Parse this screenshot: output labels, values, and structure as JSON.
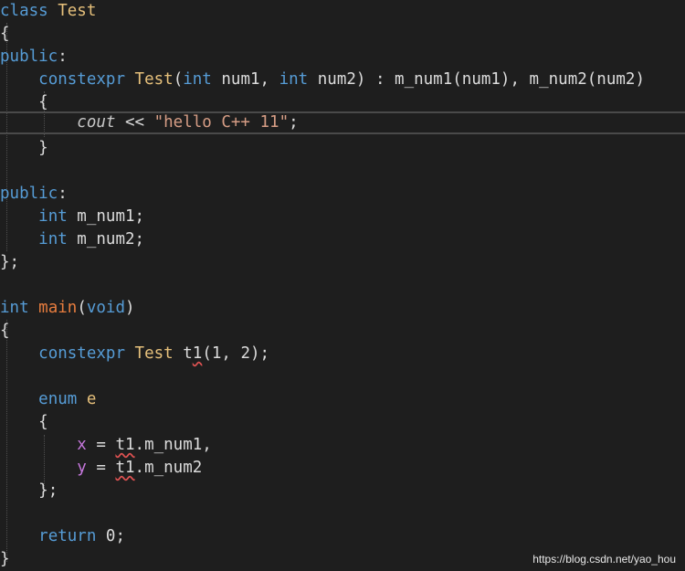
{
  "code": {
    "l1": {
      "kw": "class",
      "sp": " ",
      "name": "Test"
    },
    "l2": {
      "t": "{"
    },
    "l3": {
      "kw": "public",
      "p": ":"
    },
    "l4": {
      "kw1": "constexpr",
      "name": "Test",
      "p1": "(",
      "kw2": "int",
      "a1": " num1, ",
      "kw3": "int",
      "a2": " num2) : m_num1(num1), m_num2(num2)"
    },
    "l5": {
      "t": "{"
    },
    "l6": {
      "i": "cout",
      "op": " << ",
      "s": "\"hello C++ 11\"",
      "end": ";"
    },
    "l7": {
      "t": "}"
    },
    "l9": {
      "kw": "public",
      "p": ":"
    },
    "l10": {
      "kw": "int",
      "r": " m_num1;"
    },
    "l11": {
      "kw": "int",
      "r": " m_num2;"
    },
    "l12": {
      "t": "};"
    },
    "l14": {
      "kw": "int",
      "sp": " ",
      "fn": "main",
      "p1": "(",
      "kw2": "void",
      "p2": ")"
    },
    "l15": {
      "t": "{"
    },
    "l16": {
      "kw": "constexpr",
      "cls": "Test",
      "a": " t",
      "sq": "1",
      "r": "(1, 2);"
    },
    "l18": {
      "kw": "enum",
      "name": "e"
    },
    "l19": {
      "t": "{"
    },
    "l20": {
      "m": "x",
      "eq": " = ",
      "sq": "t1",
      "r": ".m_num1,"
    },
    "l21": {
      "m": "y",
      "eq": " = ",
      "sq": "t1",
      "r": ".m_num2"
    },
    "l22": {
      "t": "};"
    },
    "l24": {
      "kw": "return",
      "r": " 0;"
    },
    "l25": {
      "t": "}"
    }
  },
  "watermark": "https://blog.csdn.net/yao_hou"
}
